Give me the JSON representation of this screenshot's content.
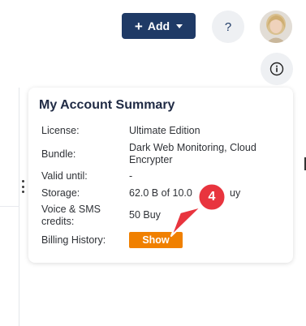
{
  "header": {
    "add_label": "Add",
    "add_plus": "+",
    "help_label": "?"
  },
  "card": {
    "title": "My Account Summary",
    "rows": [
      {
        "label": "License:",
        "value": "Ultimate Edition"
      },
      {
        "label": "Bundle:",
        "value": "Dark Web Monitoring, Cloud Encrypter"
      },
      {
        "label": "Valid until:",
        "value": "-"
      },
      {
        "label": "Storage:",
        "value": "62.0 B of 10.0",
        "value_tail": "uy"
      },
      {
        "label": "Voice & SMS credits:",
        "value": "50 Buy"
      },
      {
        "label": "Billing History:",
        "value": ""
      }
    ],
    "show_label": "Show"
  },
  "annotation": {
    "step": "4",
    "color": "#e8343e"
  },
  "icons": [
    "plus-icon",
    "chevron-down-icon",
    "help-icon",
    "info-icon",
    "avatar",
    "drag-handle-icon"
  ]
}
